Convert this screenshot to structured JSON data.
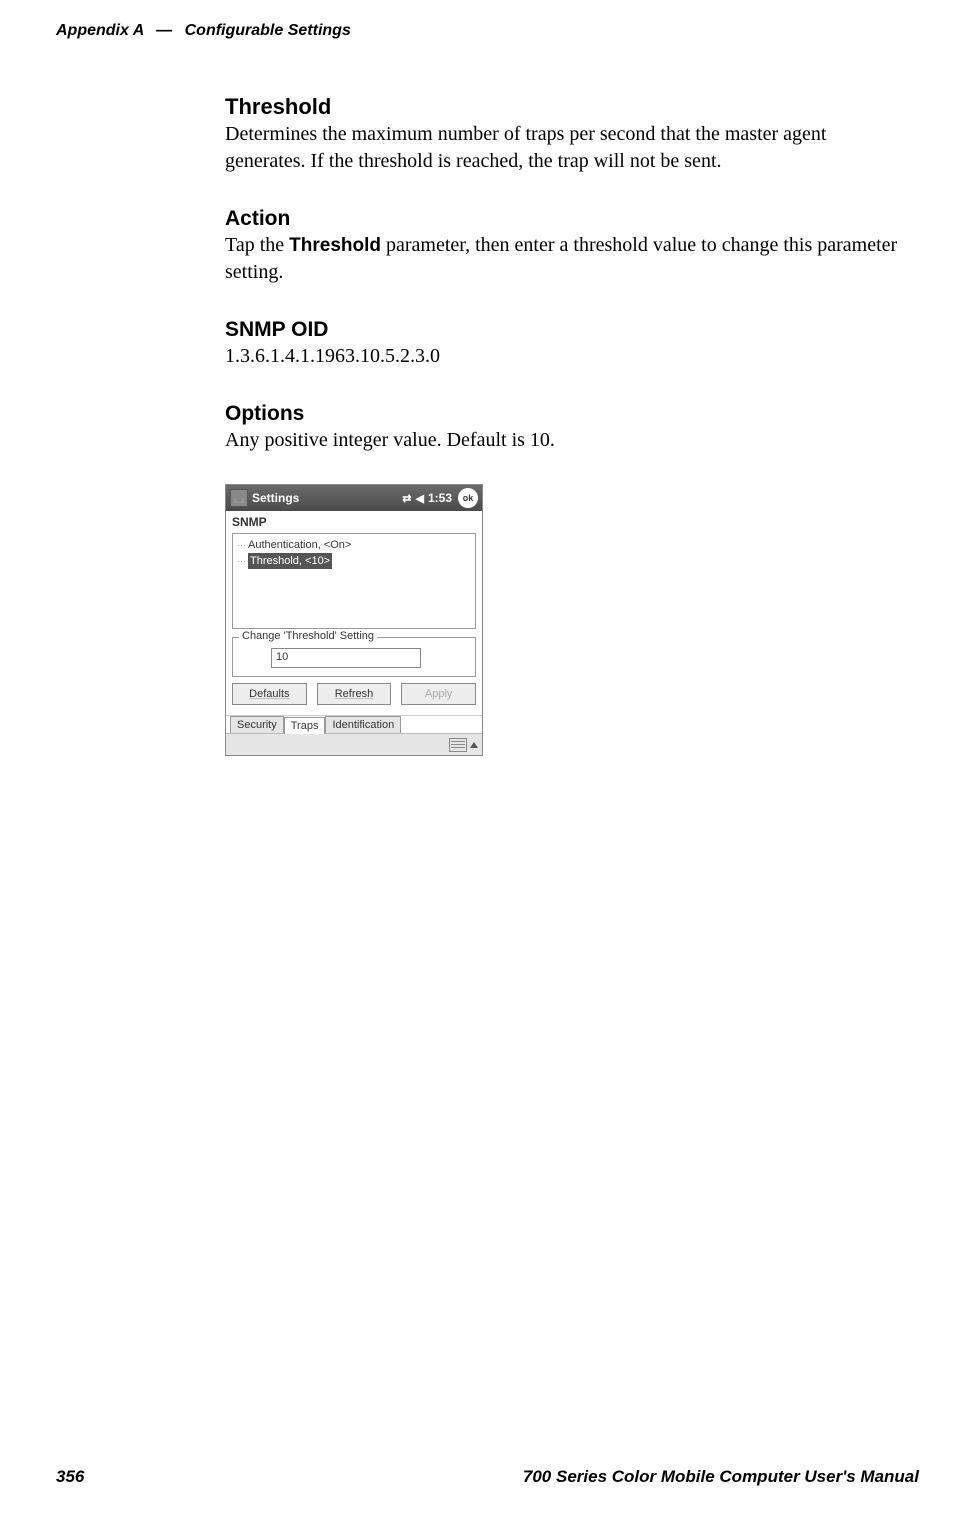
{
  "header": {
    "appendix": "Appendix A",
    "separator": "—",
    "title": "Configurable Settings"
  },
  "sections": {
    "threshold": {
      "title": "Threshold",
      "body": "Determines the maximum number of traps per second that the master agent generates. If the threshold is reached, the trap will not be sent."
    },
    "action": {
      "title": "Action",
      "pre": "Tap the ",
      "bold": "Threshold",
      "post": " parameter, then enter a threshold value to change this parameter setting."
    },
    "snmp_oid": {
      "title": "SNMP OID",
      "value": "1.3.6.1.4.1.1963.10.5.2.3.0"
    },
    "options": {
      "title": "Options",
      "body": "Any positive integer value. Default is 10."
    }
  },
  "screenshot": {
    "titlebar": {
      "title": "Settings",
      "time": "1:53",
      "ok": "ok"
    },
    "app_title": "SNMP",
    "tree": {
      "item1": "Authentication, <On>",
      "item2": "Threshold, <10>"
    },
    "group": {
      "label": "Change 'Threshold' Setting",
      "value": "10"
    },
    "buttons": {
      "defaults": "Defaults",
      "refresh": "Refresh",
      "apply": "Apply"
    },
    "tabs": {
      "security": "Security",
      "traps": "Traps",
      "identification": "Identification"
    }
  },
  "footer": {
    "page": "356",
    "manual": "700 Series Color Mobile Computer User's Manual"
  }
}
